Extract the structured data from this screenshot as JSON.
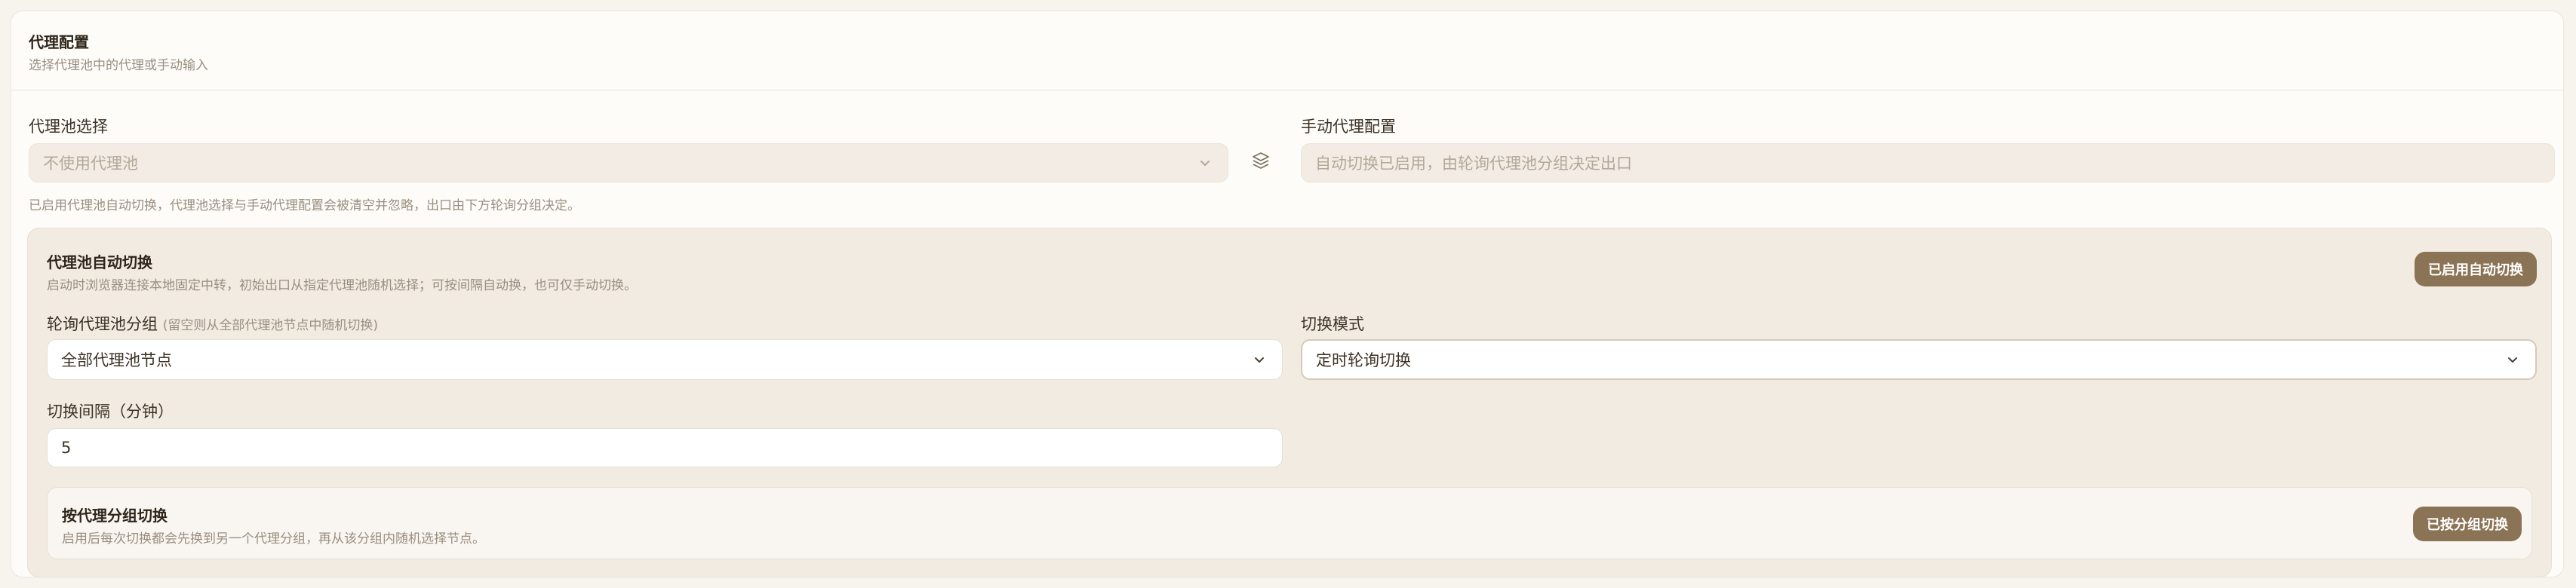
{
  "header": {
    "title": "代理配置",
    "subtitle": "选择代理池中的代理或手动输入"
  },
  "pool_select": {
    "label": "代理池选择",
    "value": "不使用代理池"
  },
  "manual_proxy": {
    "label": "手动代理配置",
    "placeholder": "自动切换已启用，由轮询代理池分组决定出口"
  },
  "notice": "已启用代理池自动切换，代理池选择与手动代理配置会被清空并忽略，出口由下方轮询分组决定。",
  "auto_switch": {
    "title": "代理池自动切换",
    "description": "启动时浏览器连接本地固定中转，初始出口从指定代理池随机选择；可按间隔自动换，也可仅手动切换。",
    "button": "已启用自动切换",
    "group": {
      "label": "轮询代理池分组",
      "hint": "(留空则从全部代理池节点中随机切换)",
      "value": "全部代理池节点"
    },
    "mode": {
      "label": "切换模式",
      "value": "定时轮询切换"
    },
    "interval": {
      "label": "切换间隔（分钟）",
      "value": "5"
    }
  },
  "group_switch": {
    "title": "按代理分组切换",
    "description": "启用后每次切换都会先换到另一个代理分组，再从该分组内随机选择节点。",
    "button": "已按分组切换"
  },
  "icons": {
    "chevron": "chevron-down-icon",
    "layers": "layers-icon"
  },
  "colors": {
    "accent": "#8b7355",
    "panel": "#f2ebe2",
    "background": "#f7f4ee"
  }
}
